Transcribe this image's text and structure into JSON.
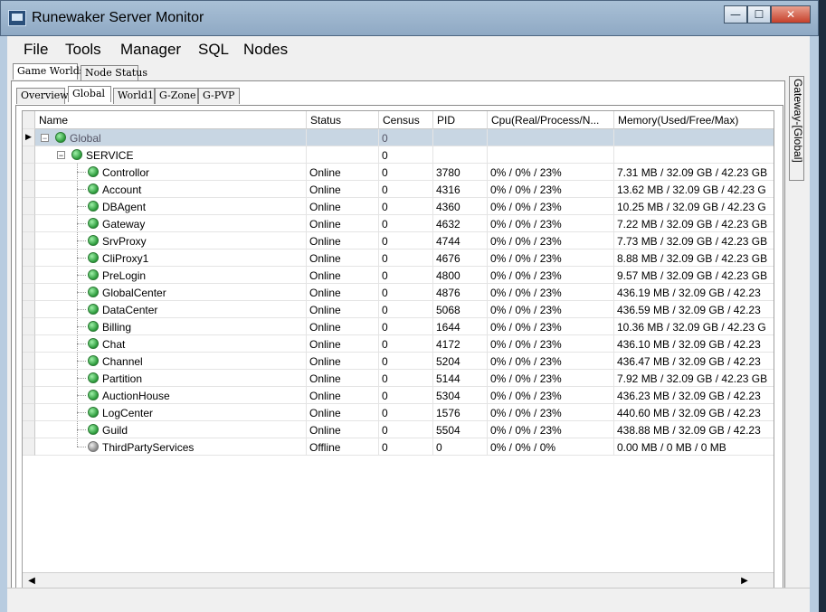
{
  "window": {
    "title": "Runewaker Server Monitor"
  },
  "menu": [
    "File",
    "Tools",
    "Manager",
    "SQL",
    "Nodes"
  ],
  "top_tabs": [
    "Game Worlds",
    "Node Status"
  ],
  "world_tabs": [
    "Overview",
    "Global",
    "World1",
    "G-Zone",
    "G-PVP"
  ],
  "side_tab": "Gateway-[Global]",
  "columns": [
    "Name",
    "Status",
    "Census",
    "PID",
    "Cpu(Real/Process/N...",
    "Memory(Used/Free/Max)"
  ],
  "rows": [
    {
      "name": "Global",
      "status": "",
      "census": "0",
      "pid": "",
      "cpu": "",
      "memory": "",
      "level": 0,
      "dot": "online",
      "selected": true
    },
    {
      "name": "SERVICE",
      "status": "",
      "census": "0",
      "pid": "",
      "cpu": "",
      "memory": "",
      "level": 1,
      "dot": "online"
    },
    {
      "name": "Controllor",
      "status": "Online",
      "census": "0",
      "pid": "3780",
      "cpu": "0% / 0% / 23%",
      "memory": "7.31 MB / 32.09 GB / 42.23 GB",
      "level": 2,
      "dot": "online"
    },
    {
      "name": "Account",
      "status": "Online",
      "census": "0",
      "pid": "4316",
      "cpu": "0% / 0% / 23%",
      "memory": "13.62 MB / 32.09 GB / 42.23 G",
      "level": 2,
      "dot": "online"
    },
    {
      "name": "DBAgent",
      "status": "Online",
      "census": "0",
      "pid": "4360",
      "cpu": "0% / 0% / 23%",
      "memory": "10.25 MB / 32.09 GB / 42.23 G",
      "level": 2,
      "dot": "online"
    },
    {
      "name": "Gateway",
      "status": "Online",
      "census": "0",
      "pid": "4632",
      "cpu": "0% / 0% / 23%",
      "memory": "7.22 MB / 32.09 GB / 42.23 GB",
      "level": 2,
      "dot": "online"
    },
    {
      "name": "SrvProxy",
      "status": "Online",
      "census": "0",
      "pid": "4744",
      "cpu": "0% / 0% / 23%",
      "memory": "7.73 MB / 32.09 GB / 42.23 GB",
      "level": 2,
      "dot": "online"
    },
    {
      "name": "CliProxy1",
      "status": "Online",
      "census": "0",
      "pid": "4676",
      "cpu": "0% / 0% / 23%",
      "memory": "8.88 MB / 32.09 GB / 42.23 GB",
      "level": 2,
      "dot": "online"
    },
    {
      "name": "PreLogin",
      "status": "Online",
      "census": "0",
      "pid": "4800",
      "cpu": "0% / 0% / 23%",
      "memory": "9.57 MB / 32.09 GB / 42.23 GB",
      "level": 2,
      "dot": "online"
    },
    {
      "name": "GlobalCenter",
      "status": "Online",
      "census": "0",
      "pid": "4876",
      "cpu": "0% / 0% / 23%",
      "memory": "436.19 MB / 32.09 GB / 42.23",
      "level": 2,
      "dot": "online"
    },
    {
      "name": "DataCenter",
      "status": "Online",
      "census": "0",
      "pid": "5068",
      "cpu": "0% / 0% / 23%",
      "memory": "436.59 MB / 32.09 GB / 42.23",
      "level": 2,
      "dot": "online"
    },
    {
      "name": "Billing",
      "status": "Online",
      "census": "0",
      "pid": "1644",
      "cpu": "0% / 0% / 23%",
      "memory": "10.36 MB / 32.09 GB / 42.23 G",
      "level": 2,
      "dot": "online"
    },
    {
      "name": "Chat",
      "status": "Online",
      "census": "0",
      "pid": "4172",
      "cpu": "0% / 0% / 23%",
      "memory": "436.10 MB / 32.09 GB / 42.23",
      "level": 2,
      "dot": "online"
    },
    {
      "name": "Channel",
      "status": "Online",
      "census": "0",
      "pid": "5204",
      "cpu": "0% / 0% / 23%",
      "memory": "436.47 MB / 32.09 GB / 42.23",
      "level": 2,
      "dot": "online"
    },
    {
      "name": "Partition",
      "status": "Online",
      "census": "0",
      "pid": "5144",
      "cpu": "0% / 0% / 23%",
      "memory": "7.92 MB / 32.09 GB / 42.23 GB",
      "level": 2,
      "dot": "online"
    },
    {
      "name": "AuctionHouse",
      "status": "Online",
      "census": "0",
      "pid": "5304",
      "cpu": "0% / 0% / 23%",
      "memory": "436.23 MB / 32.09 GB / 42.23",
      "level": 2,
      "dot": "online"
    },
    {
      "name": "LogCenter",
      "status": "Online",
      "census": "0",
      "pid": "1576",
      "cpu": "0% / 0% / 23%",
      "memory": "440.60 MB / 32.09 GB / 42.23",
      "level": 2,
      "dot": "online"
    },
    {
      "name": "Guild",
      "status": "Online",
      "census": "0",
      "pid": "5504",
      "cpu": "0% / 0% / 23%",
      "memory": "438.88 MB / 32.09 GB / 42.23",
      "level": 2,
      "dot": "online"
    },
    {
      "name": "ThirdPartyServices",
      "status": "Offline",
      "census": "0",
      "pid": "0",
      "cpu": "0% / 0% / 0%",
      "memory": "0.00 MB / 0 MB / 0 MB",
      "level": 2,
      "dot": "offline"
    }
  ]
}
